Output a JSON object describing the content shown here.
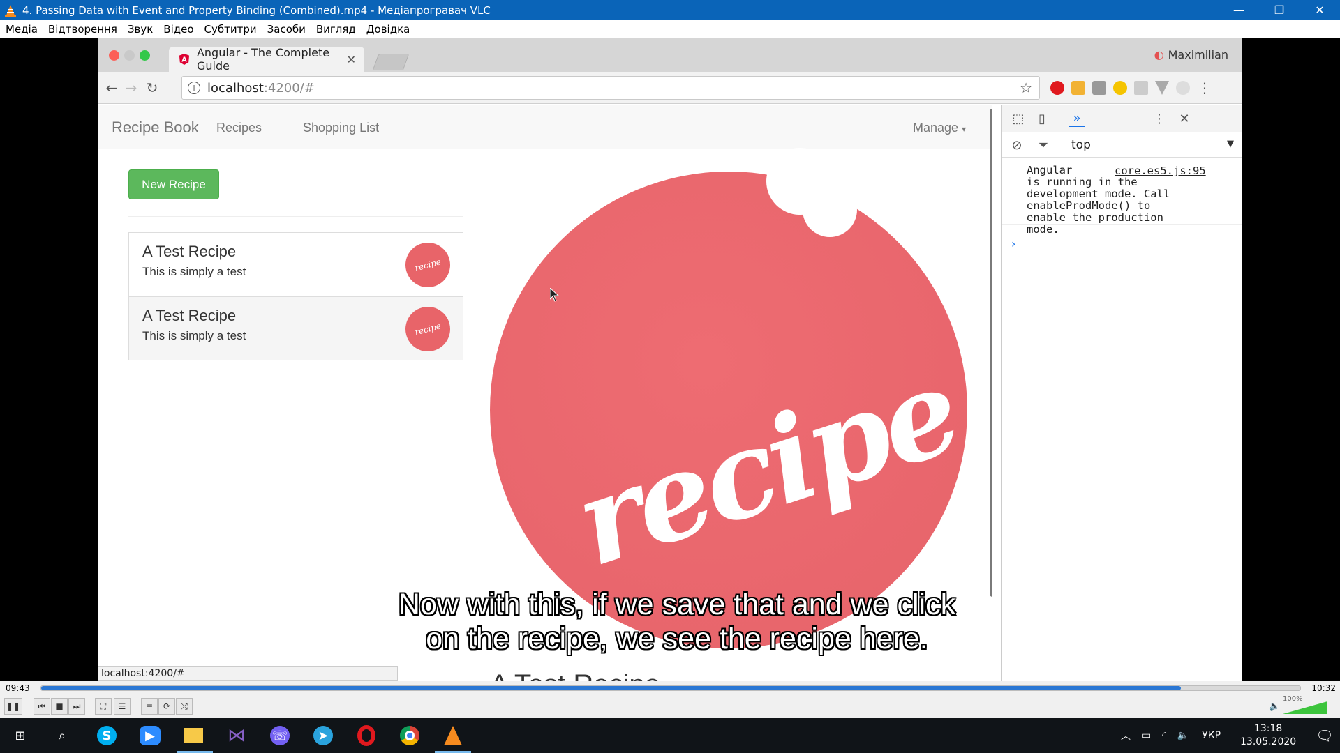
{
  "vlc": {
    "title": "4. Passing Data with Event and Property Binding (Combined).mp4 - Медіапрогравач VLC",
    "menu": [
      "Медіа",
      "Відтворення",
      "Звук",
      "Відео",
      "Субтитри",
      "Засоби",
      "Вигляд",
      "Довідка"
    ],
    "time_elapsed": "09:43",
    "time_total": "10:32",
    "progress_fraction": 0.905,
    "volume": "100%",
    "subtitle_line1": "Now with this, if we save that and we click",
    "subtitle_line2": "on the recipe, we see the recipe here."
  },
  "browser": {
    "tab_title": "Angular - The Complete Guide",
    "profile_name": "Maximilian",
    "url_host": "localhost",
    "url_rest": ":4200/#",
    "status_url": "localhost:4200/#"
  },
  "page": {
    "brand": "Recipe Book",
    "nav_recipes": "Recipes",
    "nav_shopping": "Shopping List",
    "nav_manage": "Manage",
    "new_recipe_button": "New Recipe",
    "recipes": [
      {
        "name": "A Test Recipe",
        "description": "This is simply a test",
        "image_text": "recipe"
      },
      {
        "name": "A Test Recipe",
        "description": "This is simply a test",
        "image_text": "recipe"
      }
    ],
    "big_image_text": "recipe",
    "detail_title": "A Test Recipe"
  },
  "devtools": {
    "context": "top",
    "message": "Angular\nis running in the\ndevelopment mode. Call\nenableProdMode() to\nenable the production\nmode.",
    "source": "core.es5.js:95"
  },
  "taskbar": {
    "language": "УКР",
    "time": "13:18",
    "date": "13.05.2020"
  },
  "colors": {
    "vlc_title": "#0a64b8",
    "success": "#5cb85c",
    "recipe_red": "#e86469",
    "seek_fill": "#2a77d4"
  }
}
